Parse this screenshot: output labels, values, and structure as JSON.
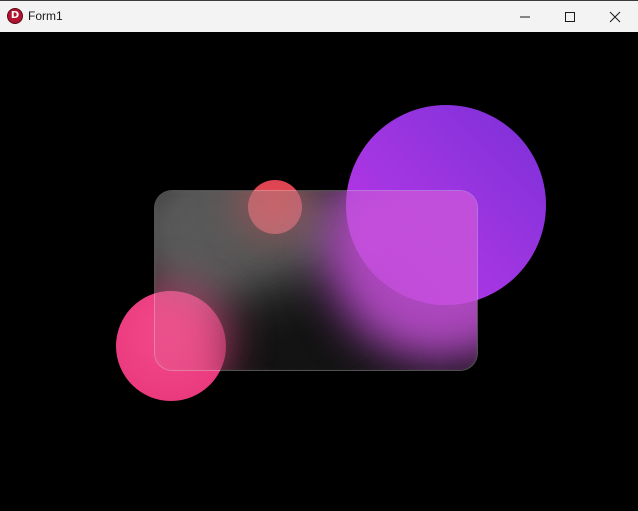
{
  "window": {
    "title": "Form1",
    "icon_letter": "D",
    "icon_name": "delphi-app-icon",
    "background": "#000000"
  },
  "controls": {
    "minimize_icon": "minimize-icon",
    "maximize_icon": "maximize-icon",
    "close_icon": "close-icon"
  },
  "scene": {
    "colors": {
      "purple_circle": "#a335e2",
      "red_circle": "#e0444f",
      "pink_circle": "#ea3a80",
      "glass_tint": "rgba(255,255,255,0.12)"
    }
  }
}
